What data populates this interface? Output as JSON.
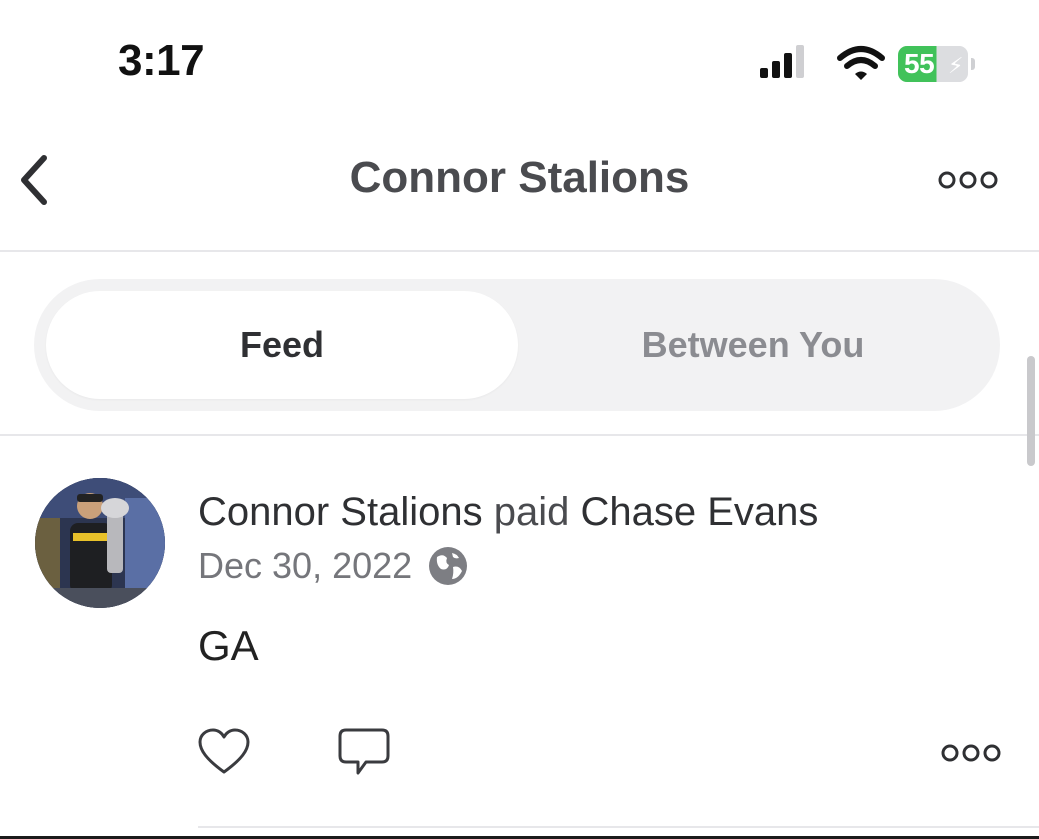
{
  "status_bar": {
    "time": "3:17",
    "battery_level": "55",
    "battery_percent": 55,
    "icons": [
      "signal-icon",
      "wifi-icon",
      "battery-charging-icon"
    ]
  },
  "header": {
    "title": "Connor Stalions",
    "icons": [
      "chevron-left-icon",
      "more-horizontal-icon"
    ]
  },
  "tabs": [
    {
      "label": "Feed",
      "active": true
    },
    {
      "label": "Between You",
      "active": false
    }
  ],
  "feed": [
    {
      "payer": "Connor Stalions",
      "verb": "paid",
      "payee": "Chase Evans",
      "date": "Dec 30, 2022",
      "note": "GA",
      "icons": [
        "avatar",
        "globe-icon",
        "heart-icon",
        "comment-icon",
        "more-horizontal-icon"
      ]
    }
  ],
  "colors": {
    "battery_green": "#41c25a",
    "text_primary": "#2f3033",
    "text_secondary": "#75767b",
    "segment_bg": "#f2f2f3"
  }
}
